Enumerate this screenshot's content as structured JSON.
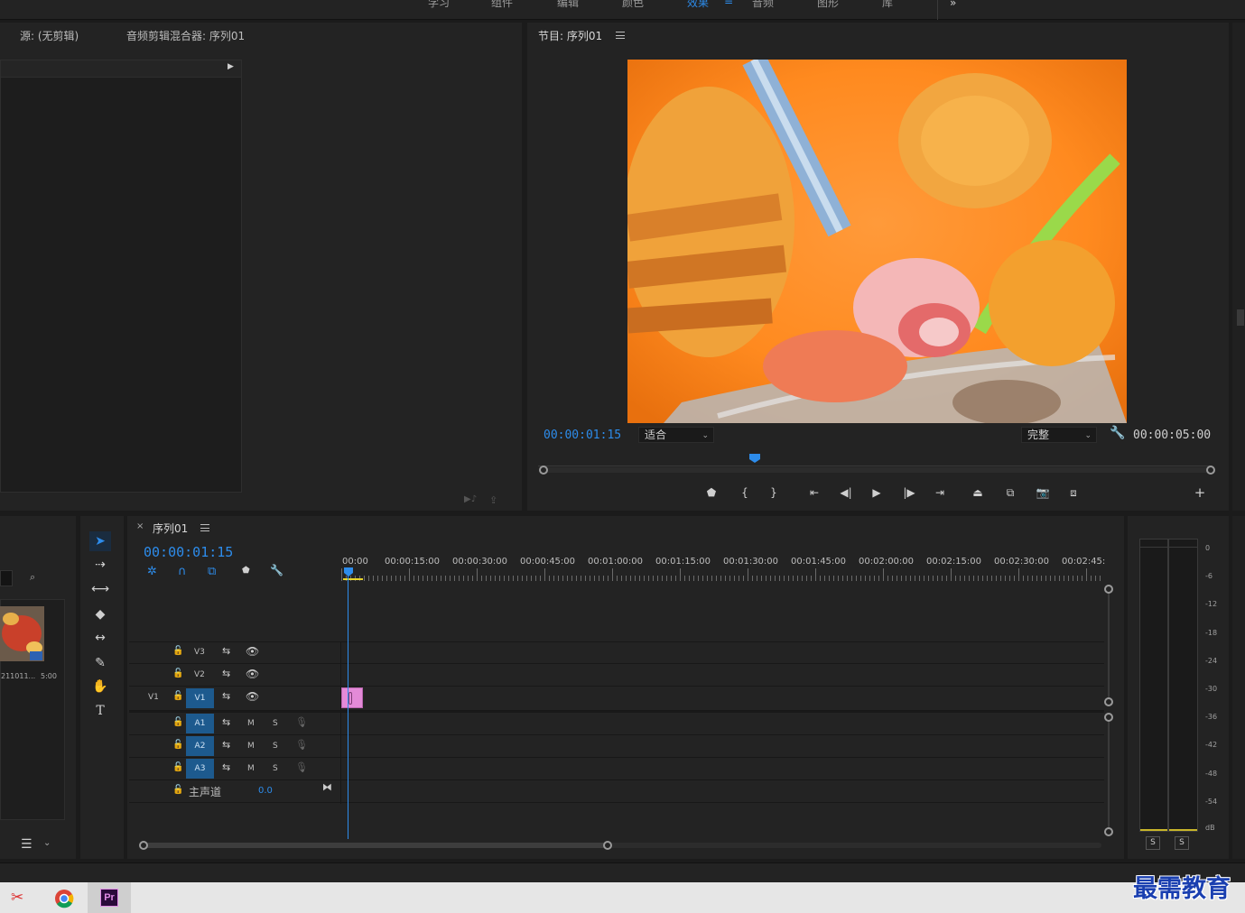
{
  "workspaces": [
    "学习",
    "组件",
    "编辑",
    "颜色",
    "效果",
    "音频",
    "图形",
    "库"
  ],
  "active_workspace": "效果",
  "source_panel": {
    "tab_source": "源: (无剪辑)",
    "tab_audio_mixer": "音频剪辑混合器: 序列01"
  },
  "program_monitor": {
    "title": "节目: 序列01",
    "current_time": "00:00:01:15",
    "zoom": "适合",
    "resolution": "完整",
    "duration": "00:00:05:00"
  },
  "project_panel": {
    "clip_name": "211011...",
    "clip_duration": "5:00"
  },
  "timeline": {
    "tab_title": "序列01",
    "current_time": "00:00:01:15",
    "ruler_labels": [
      "00:00",
      "00:00:15:00",
      "00:00:30:00",
      "00:00:45:00",
      "00:01:00:00",
      "00:01:15:00",
      "00:01:30:00",
      "00:01:45:00",
      "00:02:00:00",
      "00:02:15:00",
      "00:02:30:00",
      "00:02:45:"
    ],
    "video_tracks": [
      "V3",
      "V2",
      "V1"
    ],
    "audio_tracks": [
      "A1",
      "A2",
      "A3"
    ],
    "source_patch": "V1",
    "mute_label": "M",
    "solo_label": "S",
    "master_label": "主声道",
    "master_value": "0.0"
  },
  "audio_meter": {
    "scale": [
      "0",
      "-6",
      "-12",
      "-18",
      "-24",
      "-30",
      "-36",
      "-42",
      "-48",
      "-54",
      "dB"
    ],
    "solo_buttons": [
      "S",
      "S"
    ]
  },
  "watermark": "最需教育",
  "taskbar": {
    "premiere_label": "Pr"
  },
  "colors": {
    "accent": "#2d8ceb",
    "clip": "#e48ad8",
    "track_target": "#1d5a8e"
  }
}
